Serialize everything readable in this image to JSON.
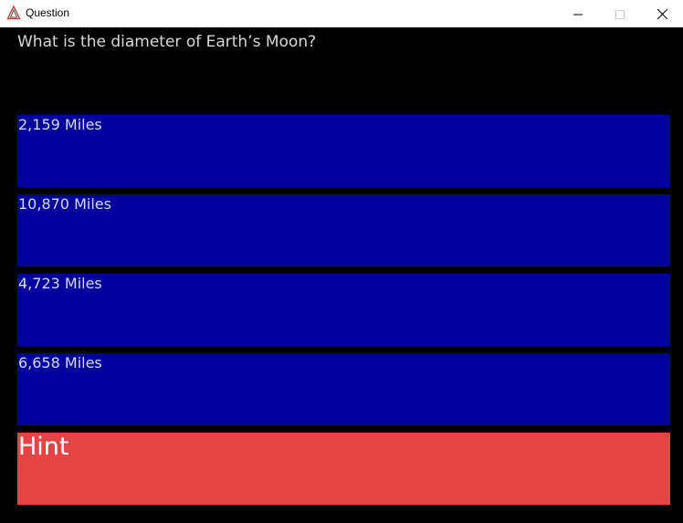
{
  "window": {
    "title": "Question",
    "app_icon": "app-triangle-icon",
    "controls": [
      "minimize-icon",
      "maximize-icon",
      "close-icon"
    ]
  },
  "question": {
    "text": "What is the diameter of Earth’s Moon?"
  },
  "answers": [
    {
      "label": "2,159 Miles"
    },
    {
      "label": "10,870 Miles"
    },
    {
      "label": "4,723 Miles"
    },
    {
      "label": "6,658 Miles"
    }
  ],
  "hint": {
    "label": "Hint"
  },
  "colors": {
    "background": "#000000",
    "answer_background": "#00009c",
    "hint_background": "#e34444",
    "question_text": "#d9d9d9"
  }
}
